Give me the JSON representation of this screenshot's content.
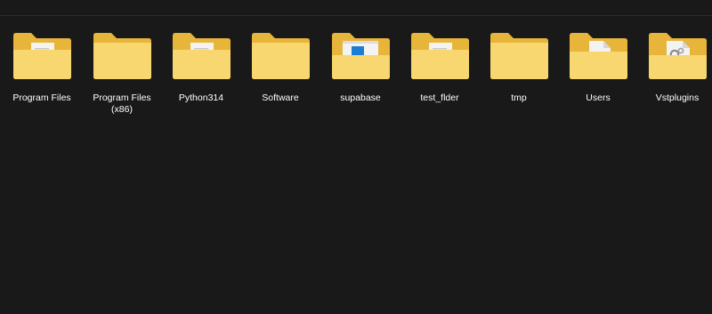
{
  "colors": {
    "background": "#191919",
    "folder_back": "#e8b53b",
    "folder_front": "#f8d670",
    "folder_front_light": "#fbe18f",
    "paper": "#f3f3f3",
    "label_text": "#ffffff"
  },
  "folders": [
    {
      "name": "Program Files",
      "name_line2": "",
      "icon": "folder-with-document-icon",
      "thumb": "doc"
    },
    {
      "name": "Program Files",
      "name_line2": "(x86)",
      "icon": "folder-empty-icon",
      "thumb": "none"
    },
    {
      "name": "Python314",
      "name_line2": "",
      "icon": "folder-with-document-icon",
      "thumb": "doc"
    },
    {
      "name": "Software",
      "name_line2": "",
      "icon": "folder-empty-icon",
      "thumb": "none"
    },
    {
      "name": "supabase",
      "name_line2": "",
      "icon": "folder-with-window-icon",
      "thumb": "window"
    },
    {
      "name": "test_flder",
      "name_line2": "",
      "icon": "folder-with-document-icon",
      "thumb": "doc"
    },
    {
      "name": "tmp",
      "name_line2": "",
      "icon": "folder-empty-icon",
      "thumb": "none"
    },
    {
      "name": "Users",
      "name_line2": "",
      "icon": "folder-with-page-icon",
      "thumb": "page"
    },
    {
      "name": "Vstplugins",
      "name_line2": "",
      "icon": "folder-with-settings-file-icon",
      "thumb": "gear"
    }
  ]
}
